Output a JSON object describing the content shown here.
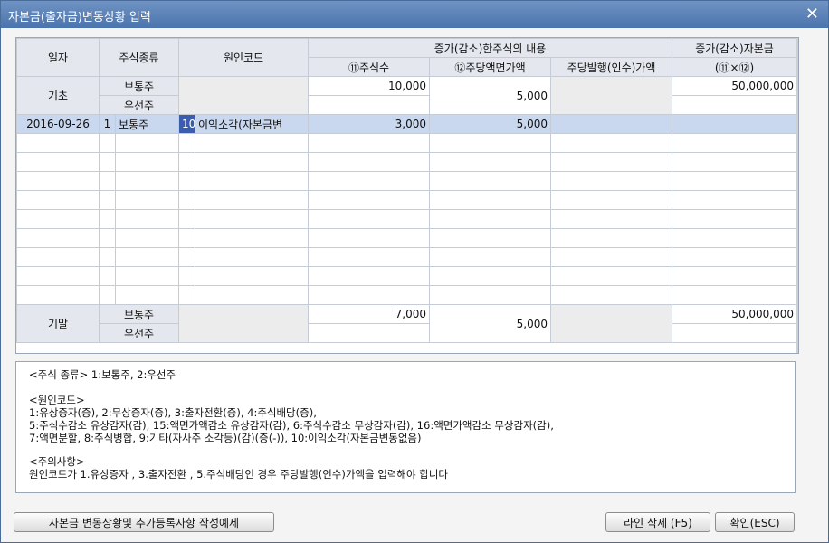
{
  "window": {
    "title": "자본금(출자금)변동상황 입력",
    "close_symbol": "✕"
  },
  "grid": {
    "headers": {
      "date": "일자",
      "stock_type": "주식종류",
      "cause_code": "원인코드",
      "change_detail": "증가(감소)한주식의 내용",
      "change_capital": "증가(감소)자본금",
      "share_count": "⑪주식수",
      "par_value": "⑫주당액면가액",
      "issue_price": "주당발행(인수)가액",
      "capital_formula": "(⑪×⑫)"
    },
    "opening": {
      "label": "기초",
      "common_label": "보통주",
      "preferred_label": "우선주",
      "common_shares": "10,000",
      "par_value": "5,000",
      "common_capital": "50,000,000"
    },
    "rows": [
      {
        "date": "2016-09-26",
        "type_code": "1",
        "type_name": "보통주",
        "cause_code": "10",
        "cause_name": "이익소각(자본금변",
        "shares": "3,000",
        "par_value": "5,000"
      }
    ],
    "closing": {
      "label": "기말",
      "common_label": "보통주",
      "preferred_label": "우선주",
      "common_shares": "7,000",
      "par_value": "5,000",
      "common_capital": "50,000,000"
    }
  },
  "info": {
    "lines": [
      "<주식 종류> 1:보통주, 2:우선주",
      "<원인코드>",
      "1:유상증자(증), 2:무상증자(증), 3:출자전환(증), 4:주식배당(증),",
      "5:주식수감소 유상감자(감), 15:액면가액감소 유상감자(감), 6:주식수감소 무상감자(감), 16:액면가액감소 무상감자(감),",
      "7:액면분할, 8:주식병합, 9:기타(자사주 소각등)(감)(증(-)), 10:이익소각(자본금변동없음)",
      "<주의사항>",
      "원인코드가 1.유상증자 , 3.출자전환 , 5.주식배당인 경우 주당발행(인수)가액을 입력해야 합니다"
    ]
  },
  "buttons": {
    "cancel_registration": "자본금 변동상황및 추가등록사항 작성예제",
    "delete_line": "라인 삭제 (F5)",
    "confirm": "확인(ESC)"
  }
}
